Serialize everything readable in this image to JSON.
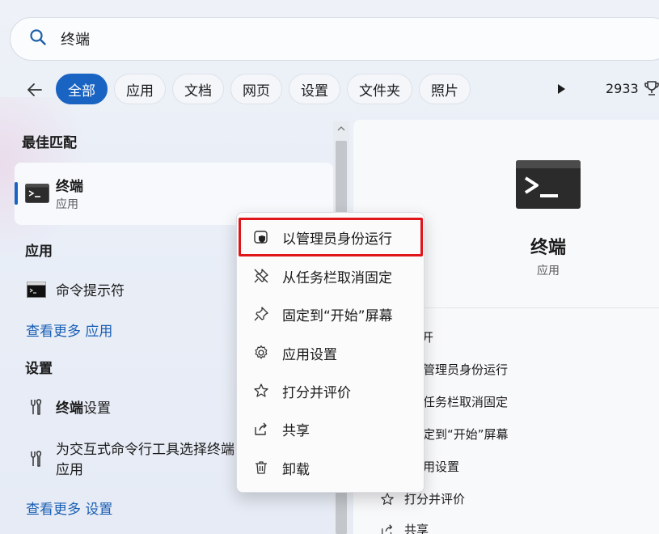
{
  "search": {
    "query": "终端"
  },
  "filters": {
    "items": [
      "全部",
      "应用",
      "文档",
      "网页",
      "设置",
      "文件夹",
      "照片"
    ],
    "active_index": 0
  },
  "header": {
    "points": "2933"
  },
  "left": {
    "best_match_title": "最佳匹配",
    "best_match": {
      "name": "终端",
      "type": "应用"
    },
    "apps_title": "应用",
    "apps": [
      {
        "name": "命令提示符"
      }
    ],
    "see_more_apps": "查看更多 应用",
    "settings_title": "设置",
    "settings": [
      {
        "bold": "终端",
        "rest": "设置"
      },
      {
        "line1": "为交互式命令行工具选择终端",
        "line2": "应用"
      }
    ],
    "see_more_settings": "查看更多 设置"
  },
  "right": {
    "name": "终端",
    "type": "应用",
    "actions": [
      "开",
      "管理员身份运行",
      "任务栏取消固定",
      "定到“开始”屏幕",
      "用设置",
      "打分并评价",
      "共享"
    ]
  },
  "context_menu": {
    "items": [
      {
        "label": "以管理员身份运行",
        "icon": "shield-icon"
      },
      {
        "label": "从任务栏取消固定",
        "icon": "unpin-icon"
      },
      {
        "label": "固定到“开始”屏幕",
        "icon": "pin-icon"
      },
      {
        "label": "应用设置",
        "icon": "gear-icon"
      },
      {
        "label": "打分并评价",
        "icon": "star-icon"
      },
      {
        "label": "共享",
        "icon": "share-icon"
      },
      {
        "label": "卸载",
        "icon": "trash-icon"
      }
    ],
    "highlight_color": "#e0151a"
  },
  "colors": {
    "accent": "#1964c3",
    "link": "#1a5fb4"
  }
}
